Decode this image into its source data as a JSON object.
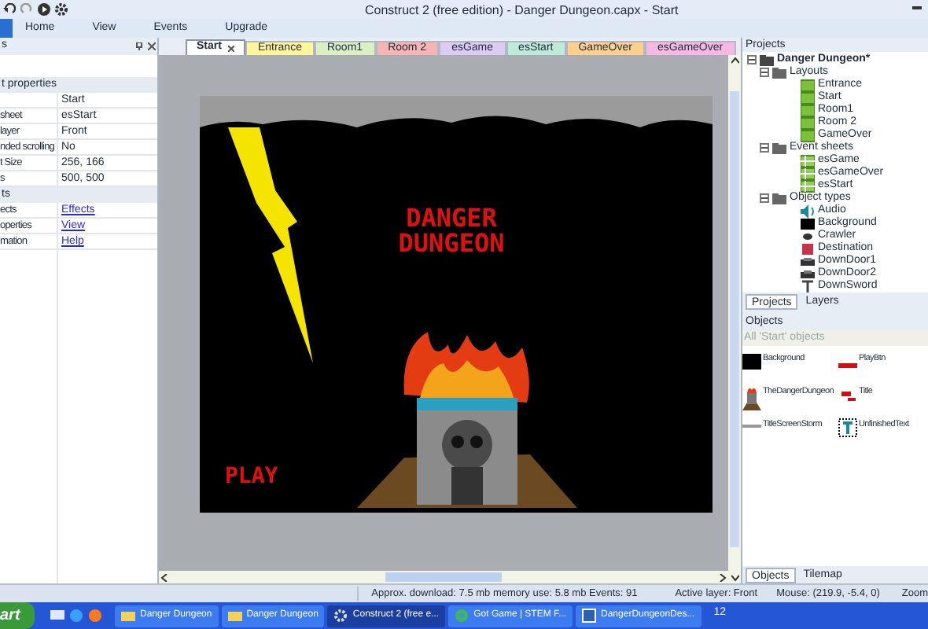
{
  "window": {
    "title": "Construct 2  (free edition) - Danger Dungeon.capx - Start"
  },
  "menu": [
    {
      "label": "Home"
    },
    {
      "label": "View"
    },
    {
      "label": "Events"
    },
    {
      "label": "Upgrade"
    }
  ],
  "left_panel": {
    "title": "s",
    "section": "t properties",
    "rows": [
      {
        "name": "",
        "value": "Start",
        "kind": "text"
      },
      {
        "name": "sheet",
        "value": "esStart",
        "kind": "text"
      },
      {
        "name": " layer",
        "value": "Front",
        "kind": "text"
      },
      {
        "name": "nded scrolling",
        "value": "No",
        "kind": "text"
      },
      {
        "name": "t Size",
        "value": "256, 166",
        "kind": "text"
      },
      {
        "name": "s",
        "value": "500, 500",
        "kind": "text"
      },
      {
        "name": "ts",
        "kind": "section"
      },
      {
        "name": "ects",
        "value": "Effects",
        "kind": "link"
      },
      {
        "name": "operties",
        "value": "View",
        "kind": "link"
      },
      {
        "name": "mation",
        "value": "Help",
        "kind": "link"
      }
    ]
  },
  "editor_tabs": [
    {
      "label": "Start",
      "selected": true,
      "color": "#ffffff",
      "closable": true
    },
    {
      "label": "Entrance",
      "selected": false,
      "color": "#fff59a"
    },
    {
      "label": "Room1",
      "selected": false,
      "color": "#d9efc4"
    },
    {
      "label": "Room 2",
      "selected": false,
      "color": "#f6b5b5"
    },
    {
      "label": "esGame",
      "selected": false,
      "color": "#dccbf3"
    },
    {
      "label": "esStart",
      "selected": false,
      "color": "#bfead9"
    },
    {
      "label": "GameOver",
      "selected": false,
      "color": "#ffcf8f"
    },
    {
      "label": "esGameOver",
      "selected": false,
      "color": "#f5b9e3"
    }
  ],
  "game": {
    "title": "DANGER DUNGEON",
    "button": "PLAY"
  },
  "projects": {
    "title": "Projects",
    "tree": [
      {
        "label": "Danger Dungeon*",
        "kind": "project",
        "expanded": true,
        "children": [
          {
            "label": "Layouts",
            "kind": "folder",
            "expanded": true,
            "children": [
              {
                "label": "Entrance",
                "kind": "layout"
              },
              {
                "label": "Start",
                "kind": "layout"
              },
              {
                "label": "Room1",
                "kind": "layout"
              },
              {
                "label": "Room 2",
                "kind": "layout"
              },
              {
                "label": "GameOver",
                "kind": "layout"
              }
            ]
          },
          {
            "label": "Event sheets",
            "kind": "folder",
            "expanded": true,
            "children": [
              {
                "label": "esGame",
                "kind": "sheet"
              },
              {
                "label": "esGameOver",
                "kind": "sheet"
              },
              {
                "label": "esStart",
                "kind": "sheet"
              }
            ]
          },
          {
            "label": "Object types",
            "kind": "folder",
            "expanded": true,
            "children": [
              {
                "label": "Audio",
                "kind": "audio"
              },
              {
                "label": "Background",
                "kind": "black"
              },
              {
                "label": "Crawler",
                "kind": "crawler"
              },
              {
                "label": "Destination",
                "kind": "red"
              },
              {
                "label": "DownDoor1",
                "kind": "door"
              },
              {
                "label": "DownDoor2",
                "kind": "door"
              },
              {
                "label": "DownSword",
                "kind": "text"
              }
            ]
          }
        ]
      }
    ],
    "tabs": [
      {
        "label": "Projects",
        "selected": true
      },
      {
        "label": "Layers",
        "selected": false
      }
    ]
  },
  "objects": {
    "title": "Objects",
    "filter": "All 'Start' objects",
    "items": [
      {
        "label": "Background",
        "kind": "black"
      },
      {
        "label": "PlayBtn",
        "kind": "play"
      },
      {
        "label": "TheDangerDungeon",
        "kind": "dungeon"
      },
      {
        "label": "Title",
        "kind": "title"
      },
      {
        "label": "TitleScreenStorm",
        "kind": "line"
      },
      {
        "label": "UnfinishedText",
        "kind": "text"
      }
    ],
    "tabs": [
      {
        "label": "Objects",
        "selected": true
      },
      {
        "label": "Tilemap",
        "selected": false
      }
    ]
  },
  "status_bar": {
    "stats": "Approx. download: 7.5 mb  memory use: 5.8 mb  Events: 91",
    "layer": "Active layer: Front",
    "mouse": "Mouse: (219.9, -5.4, 0)",
    "zoom": "Zoom"
  },
  "taskbar": {
    "start": "art",
    "items": [
      {
        "label": "Danger Dungeon",
        "kind": "folder",
        "selected": false
      },
      {
        "label": "Danger Dungeon",
        "kind": "folder",
        "selected": false
      },
      {
        "label": "Construct 2  (free e...",
        "kind": "gear",
        "selected": true
      },
      {
        "label": "Got Game | STEM F...",
        "kind": "browser",
        "selected": false
      },
      {
        "label": "DangerDungeonDes...",
        "kind": "word",
        "selected": false
      }
    ],
    "clock": "12"
  }
}
